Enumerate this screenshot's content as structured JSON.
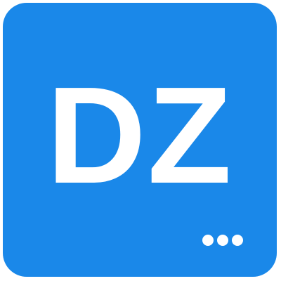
{
  "tile": {
    "initials": "DZ",
    "background_color": "#1a88e9",
    "text_color": "#ffffff"
  },
  "more_menu": {
    "icon": "more-horizontal-icon"
  }
}
